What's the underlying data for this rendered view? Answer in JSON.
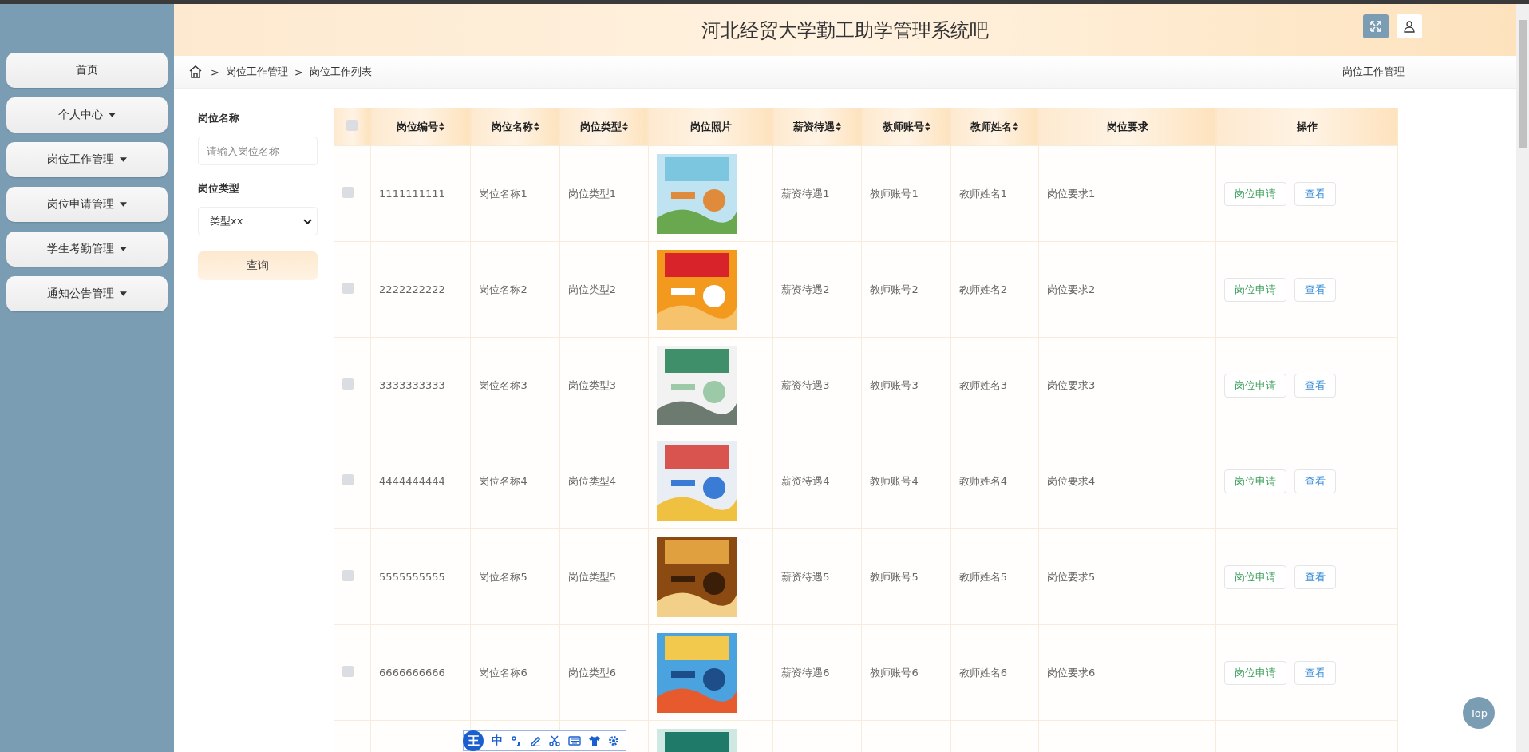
{
  "header": {
    "title": "河北经贸大学勤工助学管理系统吧"
  },
  "sidebar": {
    "items": [
      {
        "label": "首页",
        "has_menu": false
      },
      {
        "label": "个人中心",
        "has_menu": true
      },
      {
        "label": "岗位工作管理",
        "has_menu": true
      },
      {
        "label": "岗位申请管理",
        "has_menu": true
      },
      {
        "label": "学生考勤管理",
        "has_menu": true
      },
      {
        "label": "通知公告管理",
        "has_menu": true
      }
    ]
  },
  "breadcrumb": {
    "items": [
      {
        "separator": ">",
        "label": "岗位工作管理"
      },
      {
        "separator": ">",
        "label": "岗位工作列表"
      }
    ],
    "page_title": "岗位工作管理"
  },
  "filters": {
    "name_label": "岗位名称",
    "name_placeholder": "请输入岗位名称",
    "type_label": "岗位类型",
    "type_value": "类型xx",
    "search_button": "查询"
  },
  "table": {
    "all_selected": false,
    "columns": [
      {
        "label": "岗位编号",
        "sortable": true
      },
      {
        "label": "岗位名称",
        "sortable": true
      },
      {
        "label": "岗位类型",
        "sortable": true
      },
      {
        "label": "岗位照片",
        "sortable": false
      },
      {
        "label": "薪资待遇",
        "sortable": true
      },
      {
        "label": "教师账号",
        "sortable": true
      },
      {
        "label": "教师姓名",
        "sortable": true
      },
      {
        "label": "岗位要求",
        "sortable": false
      },
      {
        "label": "操作",
        "sortable": false
      }
    ],
    "rows": [
      {
        "checked": false,
        "cells": [
          {
            "kind": "text",
            "text": "1111111111"
          },
          {
            "kind": "text",
            "text": "岗位名称1"
          },
          {
            "kind": "text",
            "text": "岗位类型1"
          },
          {
            "kind": "picture"
          },
          {
            "kind": "text",
            "text": "薪资待遇1"
          },
          {
            "kind": "text",
            "text": "教师账号1"
          },
          {
            "kind": "text",
            "text": "教师姓名1"
          },
          {
            "kind": "text",
            "text": "岗位要求1"
          },
          {
            "kind": "actions",
            "actions": [
              "岗位申请",
              "查看"
            ]
          }
        ]
      },
      {
        "checked": false,
        "cells": [
          {
            "kind": "text",
            "text": "2222222222"
          },
          {
            "kind": "text",
            "text": "岗位名称2"
          },
          {
            "kind": "text",
            "text": "岗位类型2"
          },
          {
            "kind": "picture"
          },
          {
            "kind": "text",
            "text": "薪资待遇2"
          },
          {
            "kind": "text",
            "text": "教师账号2"
          },
          {
            "kind": "text",
            "text": "教师姓名2"
          },
          {
            "kind": "text",
            "text": "岗位要求2"
          },
          {
            "kind": "actions",
            "actions": [
              "岗位申请",
              "查看"
            ]
          }
        ]
      },
      {
        "checked": false,
        "cells": [
          {
            "kind": "text",
            "text": "3333333333"
          },
          {
            "kind": "text",
            "text": "岗位名称3"
          },
          {
            "kind": "text",
            "text": "岗位类型3"
          },
          {
            "kind": "picture"
          },
          {
            "kind": "text",
            "text": "薪资待遇3"
          },
          {
            "kind": "text",
            "text": "教师账号3"
          },
          {
            "kind": "text",
            "text": "教师姓名3"
          },
          {
            "kind": "text",
            "text": "岗位要求3"
          },
          {
            "kind": "actions",
            "actions": [
              "岗位申请",
              "查看"
            ]
          }
        ]
      },
      {
        "checked": false,
        "cells": [
          {
            "kind": "text",
            "text": "4444444444"
          },
          {
            "kind": "text",
            "text": "岗位名称4"
          },
          {
            "kind": "text",
            "text": "岗位类型4"
          },
          {
            "kind": "picture"
          },
          {
            "kind": "text",
            "text": "薪资待遇4"
          },
          {
            "kind": "text",
            "text": "教师账号4"
          },
          {
            "kind": "text",
            "text": "教师姓名4"
          },
          {
            "kind": "text",
            "text": "岗位要求4"
          },
          {
            "kind": "actions",
            "actions": [
              "岗位申请",
              "查看"
            ]
          }
        ]
      },
      {
        "checked": false,
        "cells": [
          {
            "kind": "text",
            "text": "5555555555"
          },
          {
            "kind": "text",
            "text": "岗位名称5"
          },
          {
            "kind": "text",
            "text": "岗位类型5"
          },
          {
            "kind": "picture"
          },
          {
            "kind": "text",
            "text": "薪资待遇5"
          },
          {
            "kind": "text",
            "text": "教师账号5"
          },
          {
            "kind": "text",
            "text": "教师姓名5"
          },
          {
            "kind": "text",
            "text": "岗位要求5"
          },
          {
            "kind": "actions",
            "actions": [
              "岗位申请",
              "查看"
            ]
          }
        ]
      },
      {
        "checked": false,
        "cells": [
          {
            "kind": "text",
            "text": "6666666666"
          },
          {
            "kind": "text",
            "text": "岗位名称6"
          },
          {
            "kind": "text",
            "text": "岗位类型6"
          },
          {
            "kind": "picture"
          },
          {
            "kind": "text",
            "text": "薪资待遇6"
          },
          {
            "kind": "text",
            "text": "教师账号6"
          },
          {
            "kind": "text",
            "text": "教师姓名6"
          },
          {
            "kind": "text",
            "text": "岗位要求6"
          },
          {
            "kind": "actions",
            "actions": [
              "岗位申请",
              "查看"
            ]
          }
        ]
      },
      {
        "cells": [
          {
            "kind": "empty"
          },
          {
            "kind": "empty"
          },
          {
            "kind": "empty"
          },
          {
            "kind": "picture"
          },
          {
            "kind": "empty"
          },
          {
            "kind": "empty"
          },
          {
            "kind": "empty"
          },
          {
            "kind": "empty"
          },
          {
            "kind": "empty"
          }
        ]
      }
    ]
  },
  "ime_toolbar": {
    "logo": "王",
    "mode": "中"
  },
  "back_to_top": "Top"
}
